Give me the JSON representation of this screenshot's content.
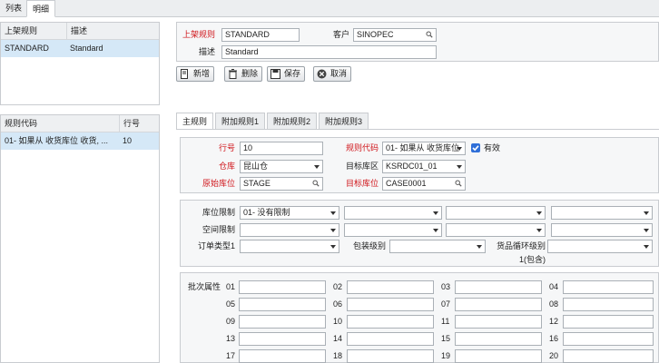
{
  "tabs": [
    "列表",
    "明细"
  ],
  "rule_table": {
    "headers": [
      "上架规则",
      "描述"
    ],
    "rows": [
      {
        "code": "STANDARD",
        "desc": "Standard"
      }
    ]
  },
  "detail_table": {
    "headers": [
      "规则代码",
      "行号"
    ],
    "rows": [
      {
        "code": "01- 如果从 收货库位 收货, ...",
        "line": "10"
      }
    ]
  },
  "header_form": {
    "rule_label": "上架规则",
    "rule_value": "STANDARD",
    "customer_label": "客户",
    "customer_value": "SINOPEC",
    "desc_label": "描述",
    "desc_value": "Standard"
  },
  "toolbar": {
    "new_label": "新增",
    "delete_label": "删除",
    "save_label": "保存",
    "cancel_label": "取消"
  },
  "subtabs": [
    "主规则",
    "附加规则1",
    "附加规则2",
    "附加规则3"
  ],
  "main_form": {
    "line_label": "行号",
    "line_value": "10",
    "rule_code_label": "规则代码",
    "rule_code_value": "01- 如果从 收货库位",
    "active_label": "有效",
    "warehouse_label": "仓库",
    "warehouse_value": "昆山仓",
    "target_zone_label": "目标库区",
    "target_zone_value": "KSRDC01_01",
    "source_loc_label": "原始库位",
    "source_loc_value": "STAGE",
    "target_loc_label": "目标库位",
    "target_loc_value": "CASE0001"
  },
  "limits": {
    "loc_limit_label": "库位限制",
    "loc_limit_value": "01- 没有限制",
    "space_limit_label": "空间限制",
    "order_type_label": "订单类型1",
    "pack_level_label": "包装级别",
    "cycle_level_label": "货品循环级别",
    "cycle_level_note": "1(包含)"
  },
  "batch": {
    "label": "批次属性",
    "numbers": [
      "01",
      "02",
      "03",
      "04",
      "05",
      "06",
      "07",
      "08",
      "09",
      "10",
      "11",
      "12",
      "13",
      "14",
      "15",
      "16",
      "17",
      "18",
      "19",
      "20"
    ]
  }
}
